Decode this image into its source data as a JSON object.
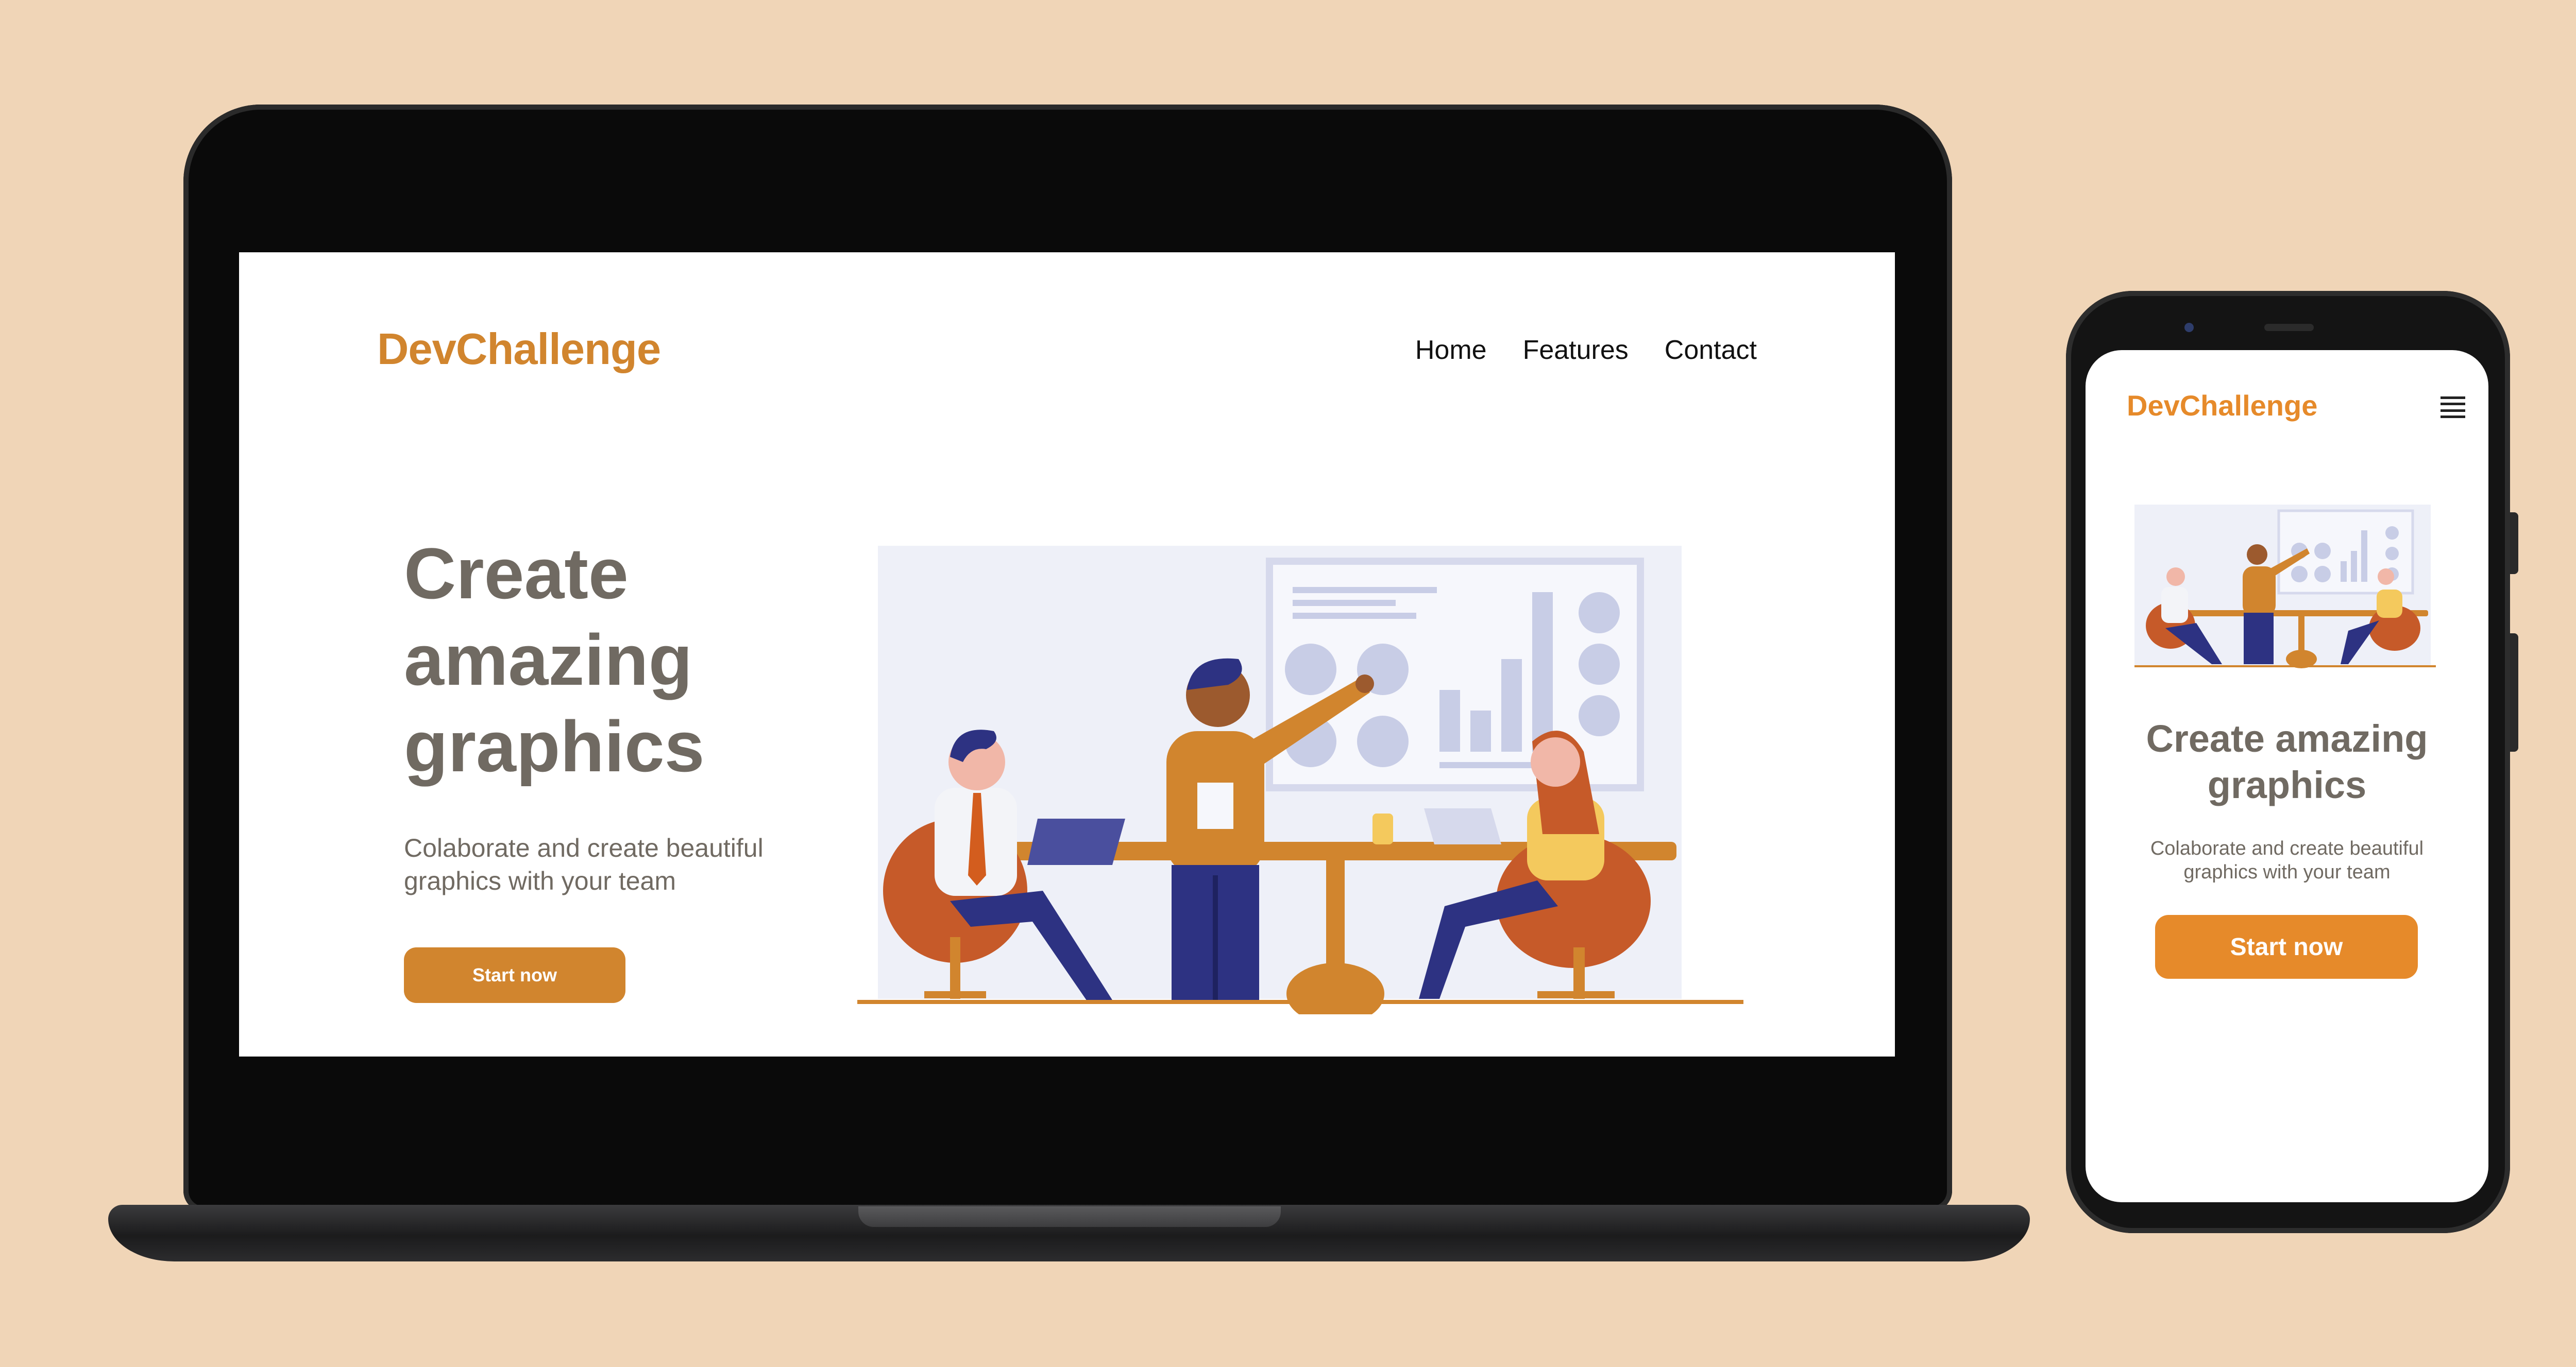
{
  "desktop": {
    "logo": "DevChallenge",
    "nav": [
      "Home",
      "Features",
      "Contact"
    ],
    "hero": {
      "title": "Create amazing graphics",
      "subtitle": "Colaborate and create beautiful graphics with your team",
      "button": "Start now"
    }
  },
  "mobile": {
    "logo": "DevChallenge",
    "hero": {
      "title": "Create amazing graphics",
      "subtitle": "Colaborate and create beautiful graphics with your team",
      "button": "Start now"
    }
  },
  "icons": {
    "menu": "hamburger-menu-icon"
  },
  "colors": {
    "background": "#f0d5b7",
    "brand_orange": "#d1852e",
    "mobile_orange": "#e68a2a",
    "heading_gray": "#706a62",
    "illustration_navy": "#2d3282",
    "illustration_bg": "#eef0f8"
  }
}
